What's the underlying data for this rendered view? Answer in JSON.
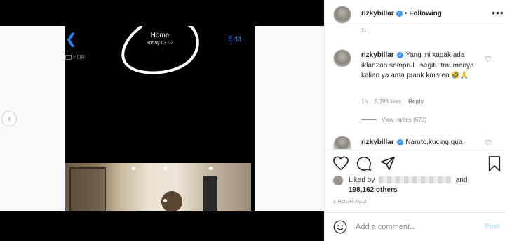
{
  "phone": {
    "title": "Home",
    "subtitle": "Today  03.02",
    "edit_label": "Edit",
    "hdr_label": "HDR",
    "back_glyph": "❮"
  },
  "carousel": {
    "prev_glyph": "‹"
  },
  "header": {
    "username": "rizkybillar",
    "separator": "•",
    "follow_status": "Following",
    "more_glyph": "•••",
    "verified_glyph": "✓"
  },
  "caption_tail": "11",
  "comments": [
    {
      "username": "rizkybillar",
      "text": "Yang ini kagak ada iklan2an semprul...segitu traumanya kalian ya ama prank kmaren 🤣🙏",
      "time": "1h",
      "likes": "5,193 likes",
      "reply_label": "Reply",
      "view_replies": "View replies (676)"
    },
    {
      "username": "rizkybillar",
      "text": "Naruto,kucing gua"
    }
  ],
  "actions": {
    "like_icon": "heart-icon",
    "comment_icon": "comment-icon",
    "share_icon": "share-icon",
    "save_icon": "bookmark-icon"
  },
  "likes": {
    "liked_by": "Liked by",
    "and": "and",
    "others": "198,162 others"
  },
  "time_ago": "1 HOUR AGO",
  "add_comment": {
    "placeholder": "Add a comment...",
    "post_label": "Post"
  },
  "colors": {
    "link_blue": "#1e88ff",
    "verified": "#3897f0",
    "post_disabled": "#b2dffc"
  }
}
